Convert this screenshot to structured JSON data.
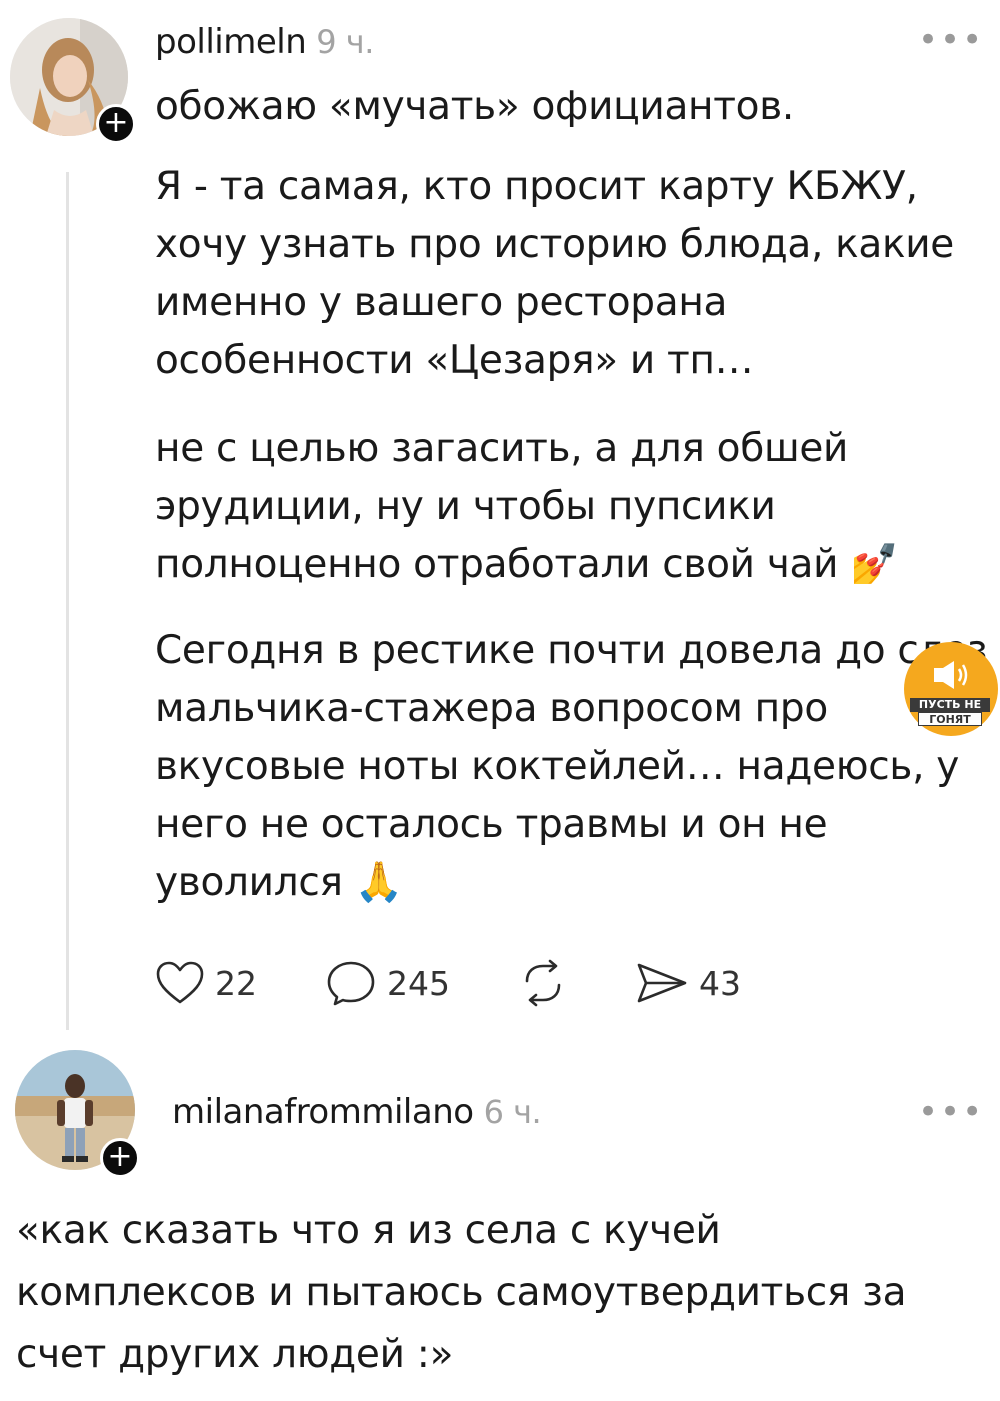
{
  "posts": [
    {
      "username": "pollimeln",
      "time": "9 ч.",
      "more_label": "•••",
      "text": "обожаю «мучать» официантов.",
      "paragraphs": [
        "Я - та самая, кто просит карту КБЖУ,\nхочу узнать про историю блюда, какие\nименно у вашего ресторана\nособенности «Цезаря» и тп…",
        "не с целью загасить, а для обшей\nэрудиции, ну и чтобы пупсики\nполноценно отработали свой чай 💅",
        "Сегодня в рестике почти довела до слез\nмальчика-стажера вопросом про\nвкусовые ноты коктейлей… надеюсь, у\nнего не осталось травмы и он не\nуволился 🙏"
      ],
      "actions": {
        "likes": "22",
        "comments": "245",
        "reposts": "",
        "shares": "43"
      },
      "icons": [
        "heart-icon",
        "comment-icon",
        "repost-icon",
        "share-icon",
        "plus-icon"
      ]
    },
    {
      "username": "milanafrommilano",
      "time": "6 ч.",
      "more_label": "•••",
      "text": "«как сказать что я из села с кучей\nкомплексов и пытаюсь самоутвердиться за\nсчет других людей :»"
    }
  ],
  "watermark": {
    "line1": "ПУСТЬ НЕ",
    "line2": "ГОНЯТ",
    "color": "#f5a81e"
  }
}
